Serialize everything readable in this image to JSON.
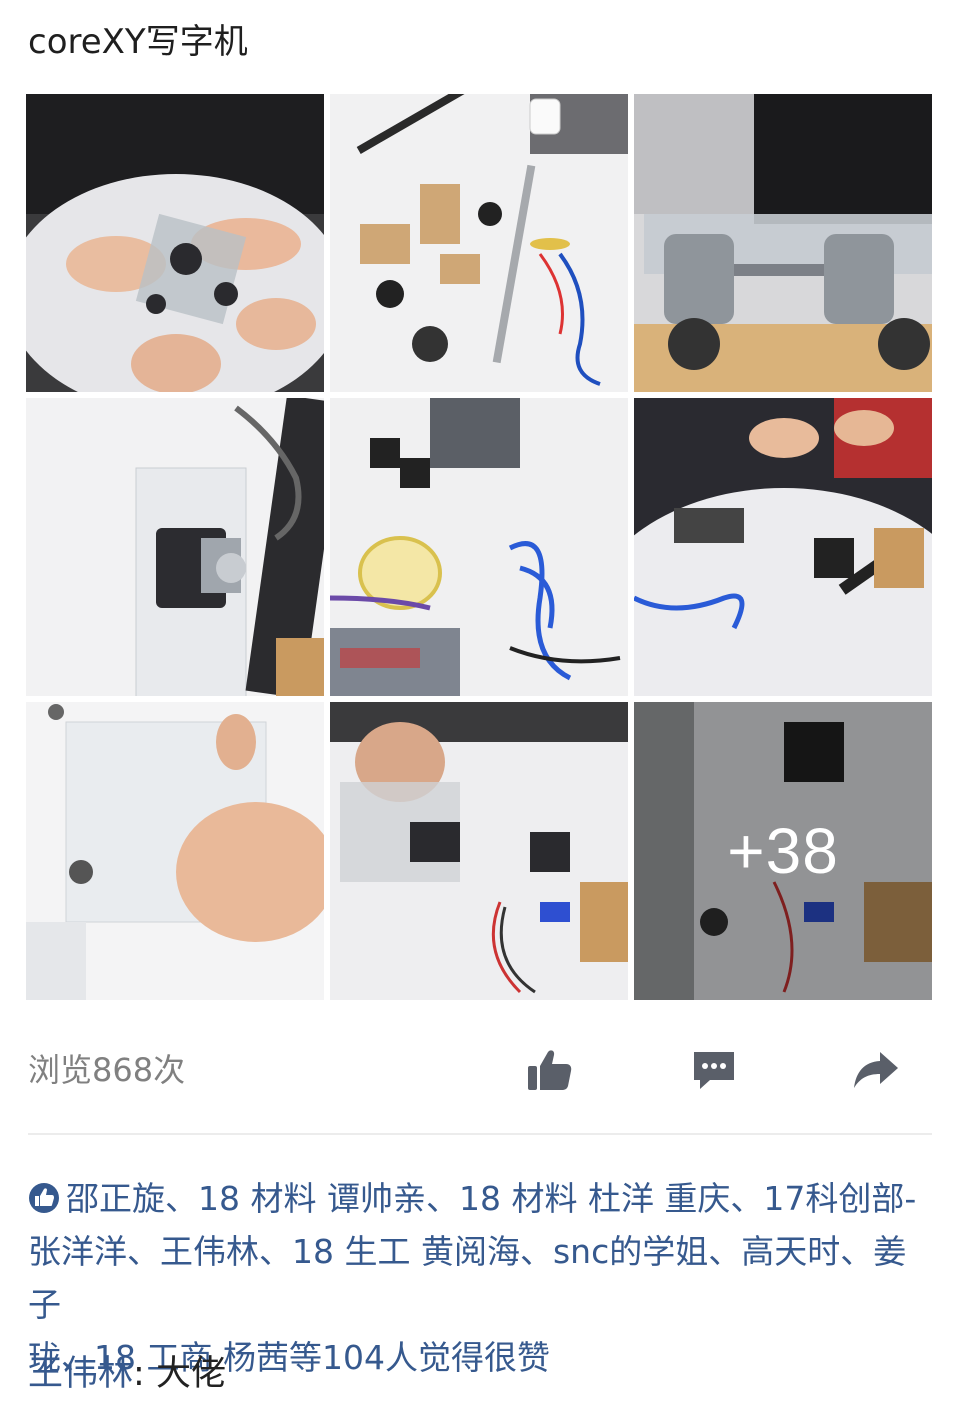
{
  "post": {
    "title": "coreXY写字机"
  },
  "photos": [
    {
      "name": "photo-hands-assembling-carriage"
    },
    {
      "name": "photo-parts-on-table"
    },
    {
      "name": "photo-coreXY-carriage-closeup"
    },
    {
      "name": "photo-stepper-motor-plate"
    },
    {
      "name": "photo-kit-parts-wires"
    },
    {
      "name": "photo-group-assembling"
    },
    {
      "name": "photo-hand-acrylic-plate"
    },
    {
      "name": "photo-hands-servo-parts"
    },
    {
      "name": "photo-more-parts"
    }
  ],
  "more_photos_label": "+38",
  "footer": {
    "view_count": "浏览868次",
    "icons": [
      "thumbs-up-icon",
      "comment-icon",
      "share-icon"
    ]
  },
  "likes": {
    "text_line1": "邵正旋、18 材料 谭帅亲、18 材料 杜洋 重庆、17科创部-",
    "text_line2": "张洋洋、王伟林、18 生工 黄阅海、snc的学姐、高天时、姜子",
    "text_line3": "珑、18 工商 杨茜等104人觉得很赞",
    "icon": "like-badge-icon"
  },
  "comment": {
    "author": "王伟林",
    "separator": ": ",
    "text": "大佬"
  },
  "colors": {
    "link_blue": "#36598e",
    "icon_gray": "#5a5f69",
    "muted_gray": "#808080"
  }
}
